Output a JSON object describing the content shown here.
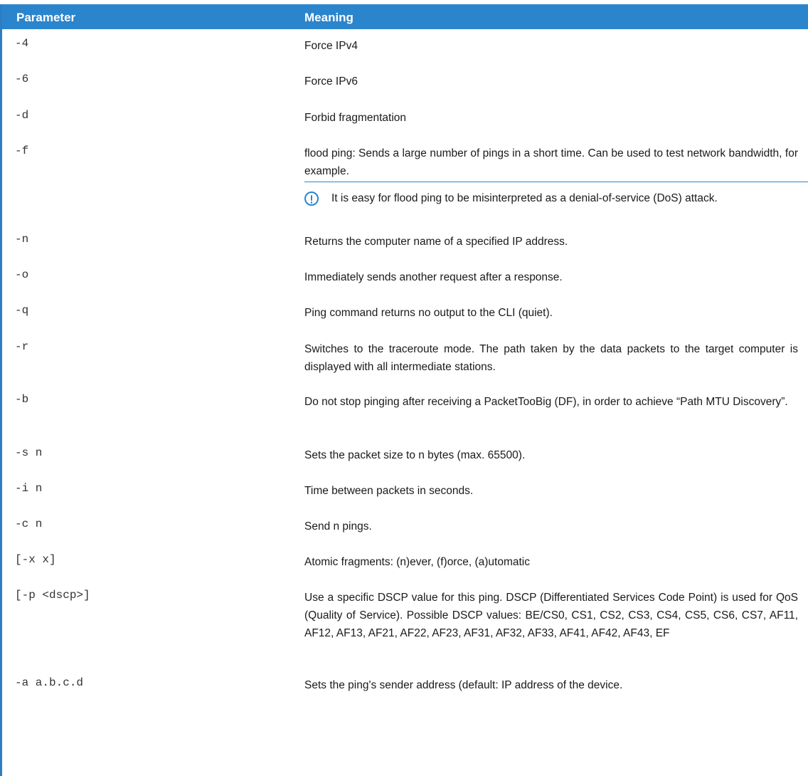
{
  "table": {
    "headers": {
      "parameter": "Parameter",
      "meaning": "Meaning"
    },
    "rows": [
      {
        "param": "-4",
        "meaning": "Force IPv4"
      },
      {
        "param": "-6",
        "meaning": "Force IPv6"
      },
      {
        "param": "-d",
        "meaning": "Forbid fragmentation"
      },
      {
        "param": "-f",
        "meaning": "flood ping: Sends a large number of pings in a short time. Can be used to test network bandwidth, for example.",
        "note": "It is easy for flood ping to be misinterpreted as a denial-of-service (DoS) attack."
      },
      {
        "param": "-n",
        "meaning": "Returns the computer name of a specified IP address."
      },
      {
        "param": "-o",
        "meaning": "Immediately sends another request after a response."
      },
      {
        "param": "-q",
        "meaning": "Ping command returns no output to the CLI (quiet)."
      },
      {
        "param": "-r",
        "meaning": "Switches to the traceroute mode. The path taken by the data packets to the target computer is displayed with all intermediate stations."
      },
      {
        "param": "-b",
        "meaning": "Do not stop pinging after receiving a PacketTooBig (DF), in order to achieve “Path MTU Discovery”."
      },
      {
        "param": "-s n",
        "meaning": "Sets the packet size to n bytes (max. 65500)."
      },
      {
        "param": "-i n",
        "meaning": "Time between packets in seconds."
      },
      {
        "param": "-c n",
        "meaning": "Send n pings."
      },
      {
        "param": "[-x x]",
        "meaning": "Atomic fragments: (n)ever, (f)orce, (a)utomatic"
      },
      {
        "param": "[-p <dscp>]",
        "meaning": "Use a specific DSCP value for this ping. DSCP (Differentiated Services Code Point) is used for QoS (Quality of Service). Possible DSCP values: BE/CS0, CS1, CS2, CS3, CS4, CS5, CS6, CS7, AF11, AF12, AF13, AF21, AF22, AF23, AF31, AF32, AF33, AF41, AF42, AF43, EF"
      },
      {
        "param": "-a a.b.c.d",
        "meaning": "Sets the ping's sender address (default: IP address of the device."
      }
    ]
  },
  "colors": {
    "header_bg": "#2b85cc",
    "accent": "#2b7ec1"
  },
  "icons": {
    "note": "exclamation-circle-icon"
  }
}
